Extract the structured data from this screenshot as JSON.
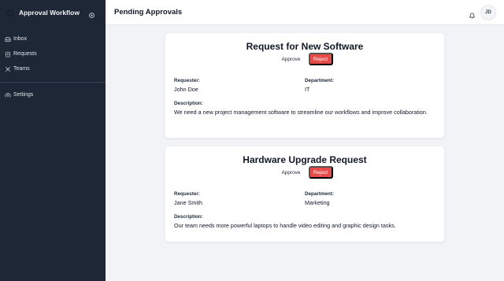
{
  "sidebar": {
    "app_title": "Approval Workflow",
    "items": [
      {
        "label": "Inbox",
        "icon": "inbox-icon"
      },
      {
        "label": "Requests",
        "icon": "clipboard-icon"
      },
      {
        "label": "Teams",
        "icon": "users-icon"
      }
    ],
    "settings_label": "Settings"
  },
  "header": {
    "title": "Pending Approvals",
    "avatar_initials": "JD"
  },
  "requests": [
    {
      "title": "Request for New Software",
      "approve_label": "Approve",
      "reject_label": "Reject",
      "requester_label": "Requester:",
      "requester": "John Doe",
      "department_label": "Department:",
      "department": "IT",
      "description_label": "Description:",
      "description": "We need a new project management software to streamline our workflows and improve collaboration."
    },
    {
      "title": "Hardware Upgrade Request",
      "approve_label": "Approve",
      "reject_label": "Reject",
      "requester_label": "Requester:",
      "requester": "Jane Smith",
      "department_label": "Department:",
      "department": "Marketing",
      "description_label": "Description:",
      "description": "Our team needs more powerful laptops to handle video editing and graphic design tasks."
    }
  ],
  "colors": {
    "sidebar_bg": "#1e2735",
    "reject": "#e84a4a",
    "page_bg": "#f1f3f6"
  }
}
